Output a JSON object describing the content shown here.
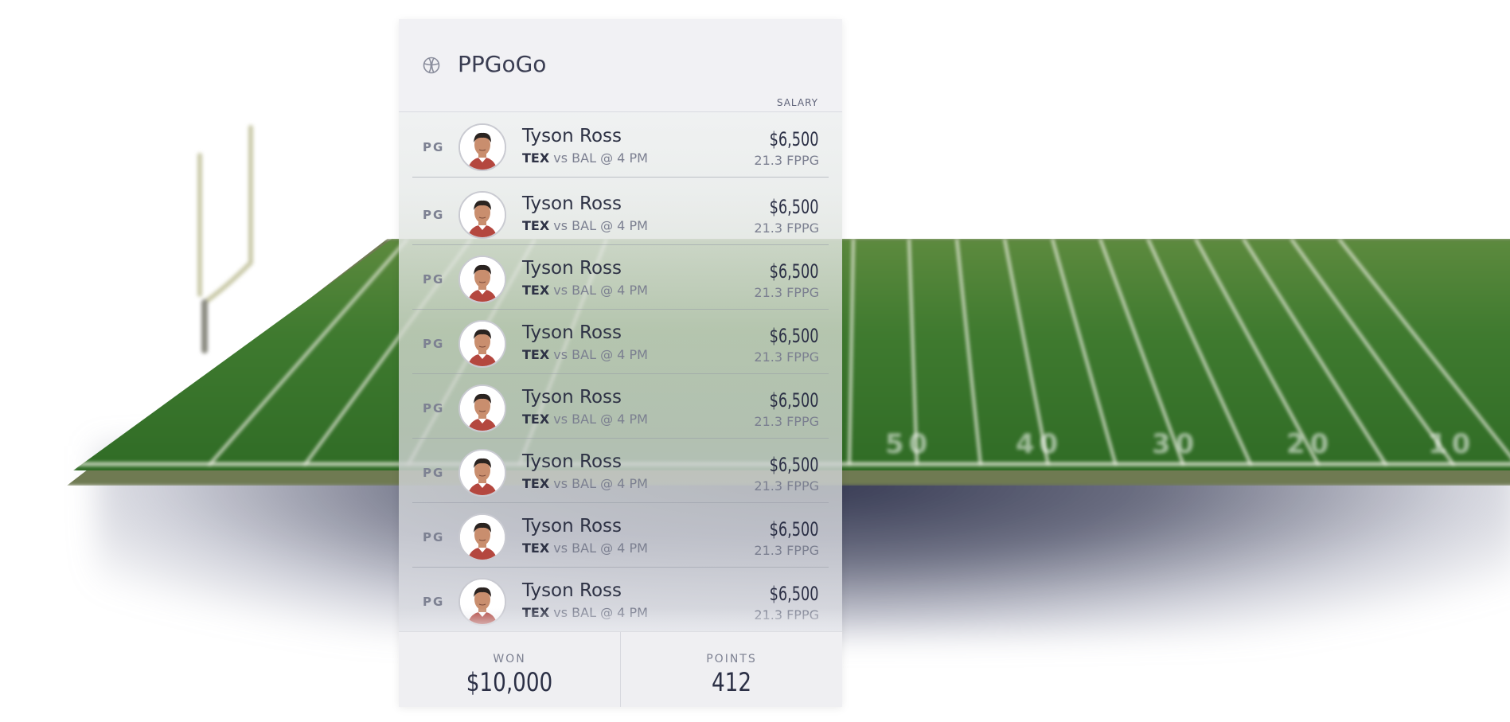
{
  "app": {
    "title": "PPGoGo",
    "icon": "basketball-icon"
  },
  "roster": {
    "salary_header": "SALARY",
    "players": [
      {
        "position": "PG",
        "name": "Tyson Ross",
        "team": "TEX",
        "matchup": " vs BAL @ 4 PM",
        "salary": "$6,500",
        "fppg": "21.3 FPPG"
      },
      {
        "position": "PG",
        "name": "Tyson Ross",
        "team": "TEX",
        "matchup": " vs BAL @ 4 PM",
        "salary": "$6,500",
        "fppg": "21.3 FPPG"
      },
      {
        "position": "PG",
        "name": "Tyson Ross",
        "team": "TEX",
        "matchup": " vs BAL @ 4 PM",
        "salary": "$6,500",
        "fppg": "21.3 FPPG"
      },
      {
        "position": "PG",
        "name": "Tyson Ross",
        "team": "TEX",
        "matchup": " vs BAL @ 4 PM",
        "salary": "$6,500",
        "fppg": "21.3 FPPG"
      },
      {
        "position": "PG",
        "name": "Tyson Ross",
        "team": "TEX",
        "matchup": " vs BAL @ 4 PM",
        "salary": "$6,500",
        "fppg": "21.3 FPPG"
      },
      {
        "position": "PG",
        "name": "Tyson Ross",
        "team": "TEX",
        "matchup": " vs BAL @ 4 PM",
        "salary": "$6,500",
        "fppg": "21.3 FPPG"
      },
      {
        "position": "PG",
        "name": "Tyson Ross",
        "team": "TEX",
        "matchup": " vs BAL @ 4 PM",
        "salary": "$6,500",
        "fppg": "21.3 FPPG"
      },
      {
        "position": "PG",
        "name": "Tyson Ross",
        "team": "TEX",
        "matchup": " vs BAL @ 4 PM",
        "salary": "$6,500",
        "fppg": "21.3 FPPG"
      }
    ]
  },
  "footer": {
    "won_label": "WON",
    "won_value": "$10,000",
    "points_label": "POINTS",
    "points_value": "412"
  },
  "background": {
    "field_numbers": [
      "50",
      "40",
      "30",
      "20",
      "10"
    ]
  }
}
